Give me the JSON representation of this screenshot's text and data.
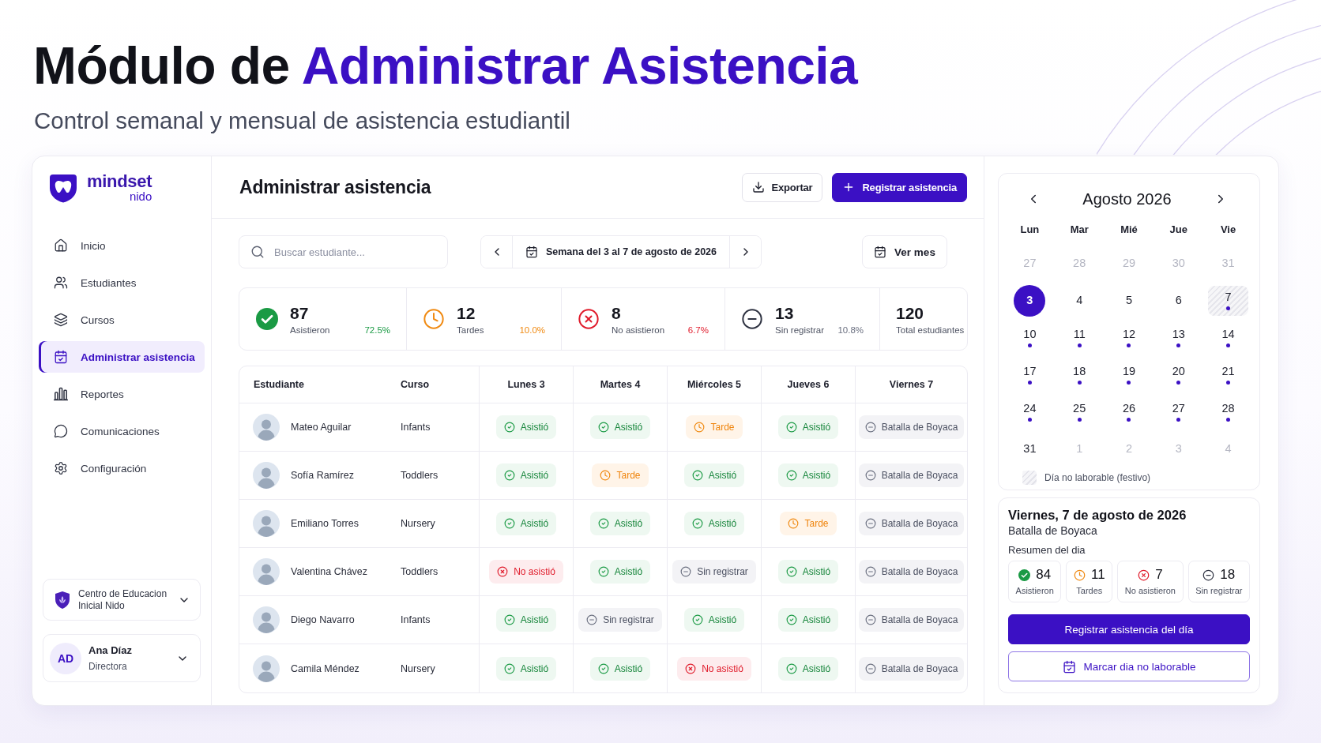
{
  "hero": {
    "title_lead": "Módulo de",
    "title_highlight": "Administrar Asistencia",
    "subtitle": "Control semanal y mensual de asistencia estudiantil"
  },
  "sidebar": {
    "brand": {
      "name": "mindset",
      "subname": "nido"
    },
    "items": [
      {
        "label": "Inicio",
        "selected": false
      },
      {
        "label": "Estudiantes",
        "selected": false
      },
      {
        "label": "Cursos",
        "selected": false
      },
      {
        "label": "Administrar asistencia",
        "selected": true
      },
      {
        "label": "Reportes",
        "selected": false
      },
      {
        "label": "Comunicaciones",
        "selected": false
      },
      {
        "label": "Configuración",
        "selected": false
      }
    ],
    "organization": "Centro de Educacion Inicial Nido",
    "user": {
      "initials": "AD",
      "name": "Ana Díaz",
      "role": "Directora"
    }
  },
  "header": {
    "title": "Administrar asistencia",
    "buttons": [
      {
        "label": "Exportar",
        "kind": "secondary"
      },
      {
        "label": "Registrar asistencia",
        "kind": "primary"
      }
    ]
  },
  "toolbar": {
    "search": {
      "placeholder": "Buscar estudiante..."
    },
    "week": "Semana del 3 al 7 de agosto de 2026",
    "month_button": "Ver mes"
  },
  "stats": [
    {
      "kind": "present",
      "value": "87",
      "label": "Asistieron",
      "percent": "72.5%"
    },
    {
      "kind": "late",
      "value": "12",
      "label": "Tardes",
      "percent": "10.0%"
    },
    {
      "kind": "absent",
      "value": "8",
      "label": "No asistieron",
      "percent": "6.7%"
    },
    {
      "kind": "unregistered",
      "value": "13",
      "label": "Sin registrar",
      "percent": "10.8%"
    },
    {
      "kind": "total",
      "value": "120",
      "label": "Total estudiantes"
    }
  ],
  "table": {
    "columns": [
      "Estudiante",
      "Curso",
      "Lunes 3",
      "Martes 4",
      "Miércoles 5",
      "Jueves 6",
      "Viernes 7"
    ],
    "rows": [
      {
        "name": "Mateo Aguilar",
        "course": "Infants",
        "days": [
          {
            "kind": "present",
            "label": "Asistió"
          },
          {
            "kind": "present",
            "label": "Asistió"
          },
          {
            "kind": "late",
            "label": "Tarde"
          },
          {
            "kind": "present",
            "label": "Asistió"
          },
          {
            "kind": "holiday",
            "label": "Batalla de Boyaca"
          }
        ]
      },
      {
        "name": "Sofía Ramírez",
        "course": "Toddlers",
        "days": [
          {
            "kind": "present",
            "label": "Asistió"
          },
          {
            "kind": "late",
            "label": "Tarde"
          },
          {
            "kind": "present",
            "label": "Asistió"
          },
          {
            "kind": "present",
            "label": "Asistió"
          },
          {
            "kind": "holiday",
            "label": "Batalla de Boyaca"
          }
        ]
      },
      {
        "name": "Emiliano Torres",
        "course": "Nursery",
        "days": [
          {
            "kind": "present",
            "label": "Asistió"
          },
          {
            "kind": "present",
            "label": "Asistió"
          },
          {
            "kind": "present",
            "label": "Asistió"
          },
          {
            "kind": "late",
            "label": "Tarde"
          },
          {
            "kind": "holiday",
            "label": "Batalla de Boyaca"
          }
        ]
      },
      {
        "name": "Valentina Chávez",
        "course": "Toddlers",
        "days": [
          {
            "kind": "absent",
            "label": "No asistió"
          },
          {
            "kind": "present",
            "label": "Asistió"
          },
          {
            "kind": "unregistered",
            "label": "Sin registrar"
          },
          {
            "kind": "present",
            "label": "Asistió"
          },
          {
            "kind": "holiday",
            "label": "Batalla de Boyaca"
          }
        ]
      },
      {
        "name": "Diego Navarro",
        "course": "Infants",
        "days": [
          {
            "kind": "present",
            "label": "Asistió"
          },
          {
            "kind": "unregistered",
            "label": "Sin registrar"
          },
          {
            "kind": "present",
            "label": "Asistió"
          },
          {
            "kind": "present",
            "label": "Asistió"
          },
          {
            "kind": "holiday",
            "label": "Batalla de Boyaca"
          }
        ]
      },
      {
        "name": "Camila Méndez",
        "course": "Nursery",
        "days": [
          {
            "kind": "present",
            "label": "Asistió"
          },
          {
            "kind": "present",
            "label": "Asistió"
          },
          {
            "kind": "absent",
            "label": "No asistió"
          },
          {
            "kind": "present",
            "label": "Asistió"
          },
          {
            "kind": "holiday",
            "label": "Batalla de Boyaca"
          }
        ]
      }
    ]
  },
  "calendar": {
    "title": "Agosto 2026",
    "weekdays": [
      "Lun",
      "Mar",
      "Mié",
      "Jue",
      "Vie"
    ],
    "days": [
      {
        "label": "27",
        "kind": "outside",
        "selected": false,
        "marked": false
      },
      {
        "label": "28",
        "kind": "outside",
        "selected": false,
        "marked": false
      },
      {
        "label": "29",
        "kind": "outside",
        "selected": false,
        "marked": false
      },
      {
        "label": "30",
        "kind": "outside",
        "selected": false,
        "marked": false
      },
      {
        "label": "31",
        "kind": "outside",
        "selected": false,
        "marked": false
      },
      {
        "label": "3",
        "kind": "day",
        "selected": true,
        "marked": false
      },
      {
        "label": "4",
        "kind": "day",
        "selected": false,
        "marked": false
      },
      {
        "label": "5",
        "kind": "day",
        "selected": false,
        "marked": false
      },
      {
        "label": "6",
        "kind": "day",
        "selected": false,
        "marked": false
      },
      {
        "label": "7",
        "kind": "holiday",
        "selected": false,
        "marked": true
      },
      {
        "label": "10",
        "kind": "day",
        "selected": false,
        "marked": true
      },
      {
        "label": "11",
        "kind": "day",
        "selected": false,
        "marked": true
      },
      {
        "label": "12",
        "kind": "day",
        "selected": false,
        "marked": true
      },
      {
        "label": "13",
        "kind": "day",
        "selected": false,
        "marked": true
      },
      {
        "label": "14",
        "kind": "day",
        "selected": false,
        "marked": true
      },
      {
        "label": "17",
        "kind": "day",
        "selected": false,
        "marked": true
      },
      {
        "label": "18",
        "kind": "day",
        "selected": false,
        "marked": true
      },
      {
        "label": "19",
        "kind": "day",
        "selected": false,
        "marked": true
      },
      {
        "label": "20",
        "kind": "day",
        "selected": false,
        "marked": true
      },
      {
        "label": "21",
        "kind": "day",
        "selected": false,
        "marked": true
      },
      {
        "label": "24",
        "kind": "day",
        "selected": false,
        "marked": true
      },
      {
        "label": "25",
        "kind": "day",
        "selected": false,
        "marked": true
      },
      {
        "label": "26",
        "kind": "day",
        "selected": false,
        "marked": true
      },
      {
        "label": "27",
        "kind": "day",
        "selected": false,
        "marked": true
      },
      {
        "label": "28",
        "kind": "day",
        "selected": false,
        "marked": true
      },
      {
        "label": "31",
        "kind": "day",
        "selected": false,
        "marked": false
      },
      {
        "label": "1",
        "kind": "outside",
        "selected": false,
        "marked": false
      },
      {
        "label": "2",
        "kind": "outside",
        "selected": false,
        "marked": false
      },
      {
        "label": "3",
        "kind": "outside",
        "selected": false,
        "marked": false
      },
      {
        "label": "4",
        "kind": "outside",
        "selected": false,
        "marked": false
      }
    ],
    "legend": "Día no laborable (festivo)"
  },
  "day_detail": {
    "title": "Viernes, 7 de agosto de 2026",
    "subtitle": "Batalla de Boyaca",
    "summary_title": "Resumen del dia",
    "summary": [
      {
        "kind": "present",
        "value": "84",
        "label": "Asistieron"
      },
      {
        "kind": "late",
        "value": "11",
        "label": "Tardes"
      },
      {
        "kind": "absent",
        "value": "7",
        "label": "No asistieron"
      },
      {
        "kind": "unregistered",
        "value": "18",
        "label": "Sin registrar"
      }
    ],
    "buttons": [
      {
        "label": "Registrar asistencia del día",
        "kind": "primary"
      },
      {
        "label": "Marcar dia no laborable",
        "kind": "outline"
      }
    ]
  }
}
